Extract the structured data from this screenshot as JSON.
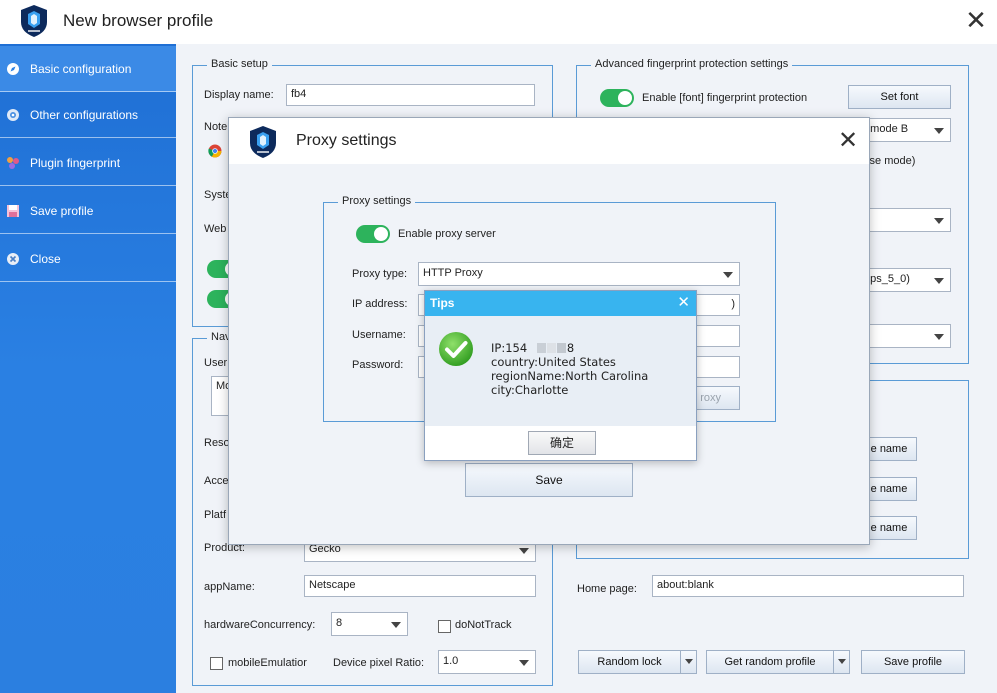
{
  "window": {
    "title": "New browser profile"
  },
  "sidebar": {
    "items": [
      {
        "label": "Basic configuration",
        "icon": "compass-icon",
        "active": true
      },
      {
        "label": "Other configurations",
        "icon": "gear-icon",
        "active": false
      },
      {
        "label": "Plugin fingerprint",
        "icon": "puzzle-icon",
        "active": false
      },
      {
        "label": "Save profile",
        "icon": "save-icon",
        "active": false
      },
      {
        "label": "Close",
        "icon": "close-circle-icon",
        "active": false
      }
    ]
  },
  "basic_setup": {
    "legend": "Basic setup",
    "display_name_label": "Display name:",
    "display_name_value": "fb4",
    "note_label": "Note",
    "system_label": "Syste",
    "webrtc_label": "Web"
  },
  "navigator": {
    "legend": "Nav",
    "user_agent_label": "User",
    "user_agent_value": "Mo",
    "resolution_label": "Reso",
    "accept_label": "Acce",
    "platform_label": "Platf",
    "product_label": "Product:",
    "product_value": "Gecko",
    "appname_label": "appName:",
    "appname_value": "Netscape",
    "hardware_label": "hardwareConcurrency:",
    "hardware_value": "8",
    "donottrack_label": "doNotTrack",
    "mobile_label": "mobileEmulatior",
    "pixel_ratio_label": "Device pixel Ratio:",
    "pixel_ratio_value": "1.0"
  },
  "advanced": {
    "legend": "Advanced fingerprint protection settings",
    "font_toggle_label": "Enable [font] fingerprint protection",
    "set_font_button": "Set font",
    "mode_select_value": "e mode B",
    "noise_mode_text": "oise mode)",
    "ps_select_value": "0 ps_5_0)",
    "rename_buttons": [
      "e name",
      "e name",
      "e name"
    ]
  },
  "bottom": {
    "home_page_label": "Home page:",
    "home_page_value": "about:blank",
    "random_lock_button": "Random lock",
    "get_random_profile_button": "Get random profile",
    "save_profile_button": "Save profile"
  },
  "proxy_dialog": {
    "title": "Proxy settings",
    "legend": "Proxy settings",
    "enable_label": "Enable proxy server",
    "proxy_type_label": "Proxy type:",
    "proxy_type_value": "HTTP Proxy",
    "ip_label": "IP address:",
    "ip_value_suffix": ")",
    "username_label": "Username:",
    "password_label": "Password:",
    "check_button_partial": "roxy",
    "save_button": "Save"
  },
  "tips": {
    "title": "Tips",
    "lines": [
      "IP:154     .98",
      "country:United States",
      "regionName:North Carolina",
      "city:Charlotte"
    ],
    "ok_button": "确定"
  },
  "colors": {
    "sidebar": "#2a80e3",
    "toggle_on": "#2db35c",
    "tips_header": "#38b4ef",
    "group_border": "#5a9bd6"
  }
}
